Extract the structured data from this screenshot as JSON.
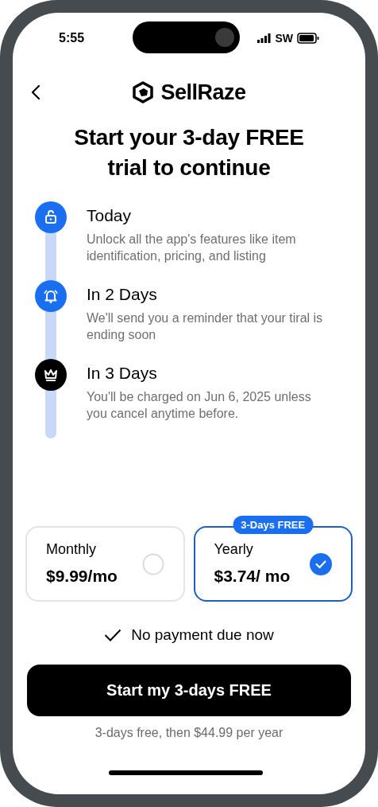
{
  "status_bar": {
    "time": "5:55",
    "carrier": "SW"
  },
  "brand": "SellRaze",
  "title": "Start your 3-day FREE trial to continue",
  "timeline": [
    {
      "kind": "unlock",
      "color": "#1a6ff0",
      "heading": "Today",
      "text": "Unlock all the app's features like item identification, pricing, and listing"
    },
    {
      "kind": "bell",
      "color": "#1a6ff0",
      "heading": "In 2 Days",
      "text": "We'll send you a reminder that your tiral is ending soon"
    },
    {
      "kind": "crown",
      "color": "#000000",
      "heading": "In 3 Days",
      "text": "You'll be charged on Jun 6, 2025 unless you cancel anytime before."
    }
  ],
  "plans": [
    {
      "name": "Monthly",
      "price": "$9.99/mo",
      "selected": false
    },
    {
      "name": "Yearly",
      "price": "$3.74/ mo",
      "selected": true,
      "badge": "3-Days FREE"
    }
  ],
  "note": "No payment due now",
  "cta": "Start my 3-days FREE",
  "footer": "3-days free, then $44.99 per year"
}
